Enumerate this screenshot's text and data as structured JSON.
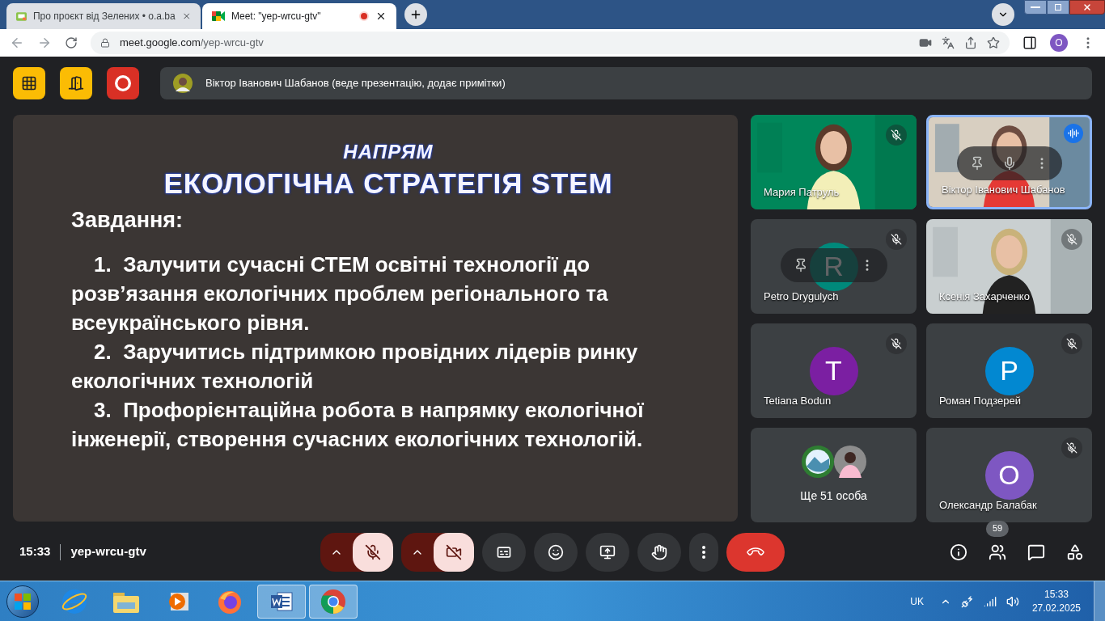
{
  "browser": {
    "tabs": [
      {
        "title": "Про проєкт від Зелених • o.a.ba",
        "kind": "site",
        "selected": false,
        "recording": false
      },
      {
        "title": "Meet: \"yep-wrcu-gtv\"",
        "kind": "meet",
        "selected": true,
        "recording": true
      }
    ],
    "url_host": "meet.google.com",
    "url_path": "/yep-wrcu-gtv",
    "profile_initial": "O"
  },
  "meet": {
    "host_controls": [
      {
        "kind": "layout"
      },
      {
        "kind": "door"
      },
      {
        "kind": "record"
      }
    ],
    "presenter_banner": "Віктор Іванович Шабанов (веде презентацію, додає примітки)",
    "slide": {
      "kicker": "НАПРЯМ",
      "title": "ЕКОЛОГІЧНА СТРАТЕГІЯ STEM",
      "heading": "Завдання:",
      "items": [
        {
          "number": "1.",
          "text": "Залучити сучасні СТЕМ освітні технології до розв’язання екологічних проблем регіонального та всеукраїнського рівня."
        },
        {
          "number": "2.",
          "text": "Заручитись підтримкою провідних лідерів ринку екологічних технологій"
        },
        {
          "number": "3.",
          "text": "Профорієнтаційна робота в напрямку екологічної інженерії, створення сучасних екологічних технологій."
        }
      ]
    },
    "tiles": [
      {
        "kind": "video",
        "name": "Мария Патруль",
        "muted": true,
        "speaking": false,
        "hover": false
      },
      {
        "kind": "video",
        "name": "Віктор Іванович Шабанов",
        "muted": false,
        "speaking": true,
        "hover": true
      },
      {
        "kind": "avatar",
        "name": "Petro Drygulych",
        "muted": true,
        "speaking": false,
        "hover": true,
        "initial": "R",
        "color": "#00897b"
      },
      {
        "kind": "video",
        "name": "Ксенія Захарченко",
        "muted": true,
        "speaking": false,
        "hover": false
      },
      {
        "kind": "avatar",
        "name": "Tetiana Bodun",
        "muted": true,
        "speaking": false,
        "hover": false,
        "initial": "T",
        "color": "#7b1fa2"
      },
      {
        "kind": "avatar",
        "name": "Роман Подзерей",
        "muted": true,
        "speaking": false,
        "hover": false,
        "initial": "P",
        "color": "#0288d1"
      },
      {
        "kind": "more",
        "name": "Ще 51 особа",
        "speaking": false
      },
      {
        "kind": "avatar",
        "name": "Олександр Балабак",
        "muted": true,
        "speaking": false,
        "hover": false,
        "initial": "O",
        "color": "#7e57c2"
      }
    ],
    "time": "15:33",
    "meeting_code": "yep-wrcu-gtv",
    "controls": [
      {
        "kind": "mic",
        "on": false
      },
      {
        "kind": "camera",
        "on": false
      },
      {
        "kind": "captions"
      },
      {
        "kind": "reactions"
      },
      {
        "kind": "present"
      },
      {
        "kind": "hand"
      },
      {
        "kind": "more"
      },
      {
        "kind": "leave"
      }
    ],
    "side_buttons": [
      {
        "kind": "info"
      },
      {
        "kind": "people",
        "badge": "59"
      },
      {
        "kind": "chat"
      },
      {
        "kind": "activities"
      }
    ]
  },
  "taskbar": {
    "apps": [
      {
        "kind": "ie",
        "active": false
      },
      {
        "kind": "explorer",
        "active": false
      },
      {
        "kind": "media",
        "active": false
      },
      {
        "kind": "firefox",
        "active": false
      },
      {
        "kind": "word",
        "active": true
      },
      {
        "kind": "chrome",
        "active": true
      }
    ],
    "language": "UK",
    "time": "15:33",
    "date": "27.02.2025"
  }
}
